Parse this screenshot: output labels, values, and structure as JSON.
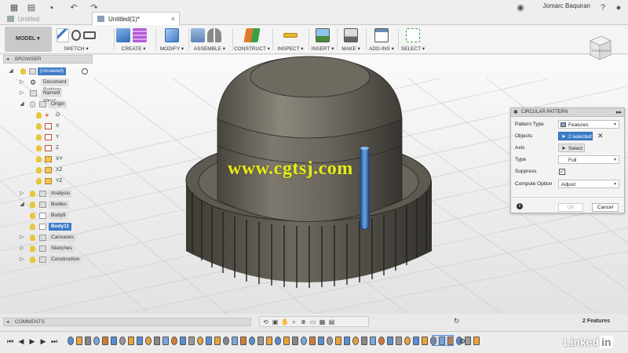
{
  "window": {
    "tabs": [
      {
        "label": "Untitled",
        "active": false
      },
      {
        "label": "Untitled(1)*",
        "active": true
      }
    ],
    "user": "Jomarc Baquiran"
  },
  "ribbon": {
    "workspace": "MODEL",
    "groups": [
      "SKETCH",
      "CREATE",
      "MODIFY",
      "ASSEMBLE",
      "CONSTRUCT",
      "INSPECT",
      "INSERT",
      "MAKE",
      "ADD-INS",
      "SELECT"
    ]
  },
  "browser": {
    "title": "BROWSER",
    "root": "(Unsaved)",
    "items": [
      {
        "label": "Document Settings"
      },
      {
        "label": "Named Views"
      },
      {
        "label": "Origin"
      },
      {
        "label": "O"
      },
      {
        "label": "X"
      },
      {
        "label": "Y"
      },
      {
        "label": "Z"
      },
      {
        "label": "XY"
      },
      {
        "label": "XZ"
      },
      {
        "label": "YZ"
      },
      {
        "label": "Analysis"
      },
      {
        "label": "Bodies"
      },
      {
        "label": "Body9"
      },
      {
        "label": "Body11"
      },
      {
        "label": "Canvases"
      },
      {
        "label": "Sketches"
      },
      {
        "label": "Construction"
      }
    ]
  },
  "viewcube": {
    "face_front": "FRONT",
    "face_right": "RIGHT"
  },
  "dialog": {
    "title": "CIRCULAR PATTERN",
    "pattern_type_label": "Pattern Type",
    "pattern_type_value": "Features",
    "objects_label": "Objects",
    "objects_value": "2 selected",
    "axis_label": "Axis",
    "axis_value": "Select",
    "type_label": "Type",
    "type_value": "Full",
    "suppress_label": "Suppress",
    "compute_label": "Compute Option",
    "compute_value": "Adjust",
    "ok_label": "OK",
    "cancel_label": "Cancel"
  },
  "comments": {
    "label": "COMMENTS"
  },
  "status": {
    "features_count": "2 Features"
  },
  "watermark": "www.cgtsj.com",
  "brand": {
    "linkedin_text": "Linked",
    "linkedin_in": "in"
  },
  "colors": {
    "accent_blue": "#3d7cc9",
    "selection_blue": "#2f6db5",
    "ribbon_bg": "#f4f4f4",
    "viewport_bg": "#ececec",
    "model_body": "#6b675e",
    "watermark_yellow": "#e8ea1a"
  }
}
